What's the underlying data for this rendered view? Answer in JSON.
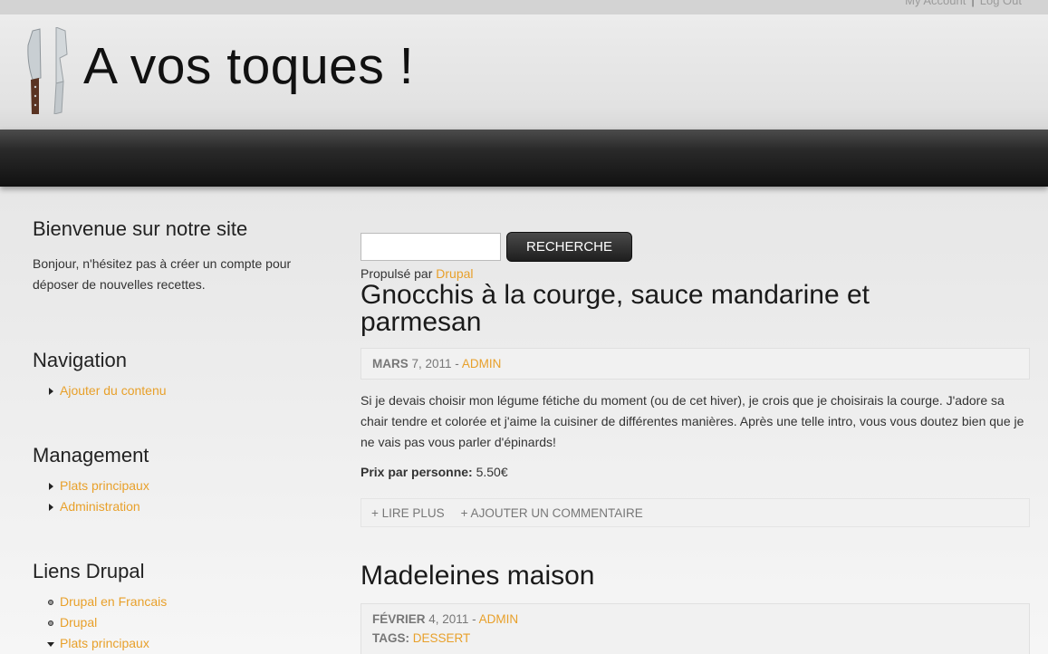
{
  "top_links": {
    "account": "My Account",
    "separator": "|",
    "logout": "Log Out"
  },
  "site": {
    "title": "A vos toques !"
  },
  "search": {
    "placeholder": "",
    "button": "RECHERCHE"
  },
  "powered": {
    "prefix": "Propulsé par",
    "link": "Drupal"
  },
  "sidebar": {
    "welcome": {
      "title": "Bienvenue sur notre site",
      "text": "Bonjour, n'hésitez pas à créer un compte pour déposer de nouvelles recettes."
    },
    "navigation": {
      "title": "Navigation",
      "items": [
        "Ajouter du contenu"
      ]
    },
    "management": {
      "title": "Management",
      "items": [
        "Plats principaux",
        "Administration"
      ]
    },
    "drupal_links": {
      "title": "Liens Drupal",
      "items": [
        "Drupal en Francais",
        "Drupal",
        "Plats principaux"
      ]
    }
  },
  "articles": [
    {
      "title": "Gnocchis à la courge, sauce mandarine et parmesan",
      "month": "MARS",
      "date_rest": "7, 2011 -",
      "author": "ADMIN",
      "body": "Si je devais choisir mon légume fétiche du moment (ou de cet hiver), je crois que je choisirais la courge. J'adore sa chair tendre et colorée et j'aime la cuisiner de différentes manières. Après une telle intro, vous vous doutez bien que je ne vais pas vous parler d'épinards!",
      "price_label": "Prix par personne:",
      "price_value": "5.50€",
      "read_more": "+ LIRE PLUS",
      "add_comment": "+ AJOUTER UN COMMENTAIRE"
    },
    {
      "title": "Madeleines maison",
      "month": "FÉVRIER",
      "date_rest": "4, 2011 -",
      "author": "ADMIN",
      "tags_label": "TAGS:",
      "tag": "DESSERT"
    }
  ]
}
